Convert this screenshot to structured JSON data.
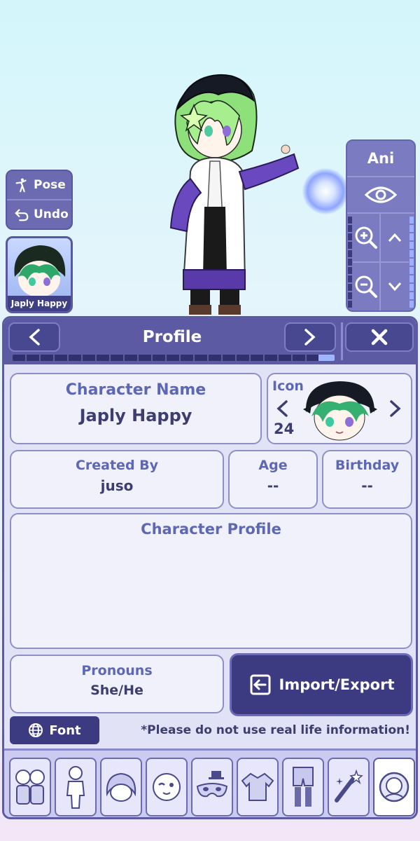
{
  "scene": {
    "pose_label": "Pose",
    "undo_label": "Undo",
    "character_thumb_name": "Japly Happy",
    "ani_label": "Ani"
  },
  "profile": {
    "title": "Profile",
    "close_label": "X",
    "prev_label": "<",
    "next_label": ">",
    "progress_fraction": 0.05,
    "character_name_label": "Character Name",
    "character_name": "Japly Happy",
    "icon_label": "Icon",
    "icon_number": "24",
    "created_by_label": "Created By",
    "created_by": "juso",
    "age_label": "Age",
    "age": "--",
    "birthday_label": "Birthday",
    "birthday": "--",
    "character_profile_label": "Character Profile",
    "character_profile_text": "",
    "pronouns_label": "Pronouns",
    "pronouns": "She/He",
    "import_export_label": "Import/Export",
    "font_label": "Font",
    "note": "*Please do not use real life information!"
  },
  "tabs": [
    {
      "name": "characters",
      "icon": "duo-chibi-icon"
    },
    {
      "name": "body",
      "icon": "body-silhouette-icon"
    },
    {
      "name": "hair",
      "icon": "hair-icon"
    },
    {
      "name": "face",
      "icon": "face-wink-icon"
    },
    {
      "name": "accessories",
      "icon": "mask-hat-icon"
    },
    {
      "name": "top",
      "icon": "shirt-icon"
    },
    {
      "name": "bottom",
      "icon": "pants-icon"
    },
    {
      "name": "props",
      "icon": "magic-wand-icon"
    },
    {
      "name": "profile",
      "icon": "profile-face-icon",
      "active": true
    }
  ],
  "colors": {
    "panel": "#5b5aa3",
    "dark_button": "#3c3b82",
    "label_text": "#5c67b5",
    "value_text": "#3d3d6f"
  }
}
